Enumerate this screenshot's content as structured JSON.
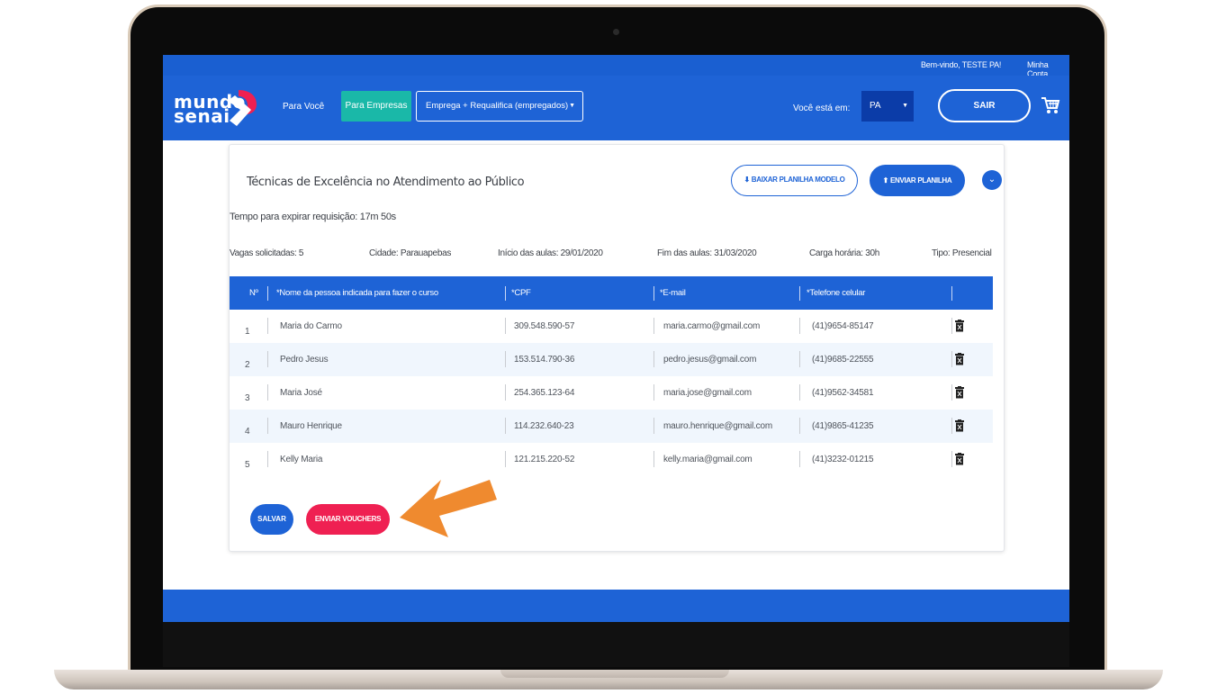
{
  "topbar": {
    "welcome": "Bem-vindo, TESTE PA!",
    "account": "Minha Conta"
  },
  "header": {
    "logo_line1": "mundo",
    "logo_line2": "senai",
    "nav_para_voce": "Para Você",
    "nav_para_empresas": "Para Empresas",
    "program_select": "Emprega + Requalifica (empregados)",
    "location_label": "Você está em:",
    "location_value": "PA",
    "logout": "SAIR",
    "cart_icon": "shopping-cart-icon"
  },
  "course": {
    "title": "Técnicas de Excelência no Atendimento ao Público",
    "download_button": "BAIXAR PLANILHA MODELO",
    "upload_button": "ENVIAR PLANILHA",
    "expire": "Tempo para expirar requisição: 17m 50s",
    "vagas": "Vagas solicitadas: 5",
    "cidade": "Cidade: Parauapebas",
    "inicio": "Início das aulas: 29/01/2020",
    "fim": "Fim das aulas: 31/03/2020",
    "carga": "Carga horária: 30h",
    "tipo": "Tipo: Presencial"
  },
  "table": {
    "headers": [
      "Nº",
      "*Nome da pessoa indicada para fazer o curso",
      "*CPF",
      "*E-mail",
      "*Telefone celular"
    ],
    "rows": [
      {
        "n": "1",
        "nome": "Maria do Carmo",
        "cpf": "309.548.590-57",
        "email": "maria.carmo@gmail.com",
        "tel": "(41)9654-85147"
      },
      {
        "n": "2",
        "nome": "Pedro Jesus",
        "cpf": "153.514.790-36",
        "email": "pedro.jesus@gmail.com",
        "tel": "(41)9685-22555"
      },
      {
        "n": "3",
        "nome": "Maria José",
        "cpf": "254.365.123-64",
        "email": "maria.jose@gmail.com",
        "tel": "(41)9562-34581"
      },
      {
        "n": "4",
        "nome": "Mauro Henrique",
        "cpf": "114.232.640-23",
        "email": "mauro.henrique@gmail.com",
        "tel": "(41)9865-41235"
      },
      {
        "n": "5",
        "nome": "Kelly Maria",
        "cpf": "121.215.220-52",
        "email": "kelly.maria@gmail.com",
        "tel": "(41)3232-01215"
      }
    ]
  },
  "actions": {
    "save": "SALVAR",
    "send_vouchers": "ENVIAR VOUCHERS"
  },
  "colors": {
    "primary": "#1e63d6",
    "teal": "#1ab8a8",
    "danger": "#ef2052",
    "arrow": "#ef8a2f",
    "row_alt": "#f0f6fd"
  }
}
